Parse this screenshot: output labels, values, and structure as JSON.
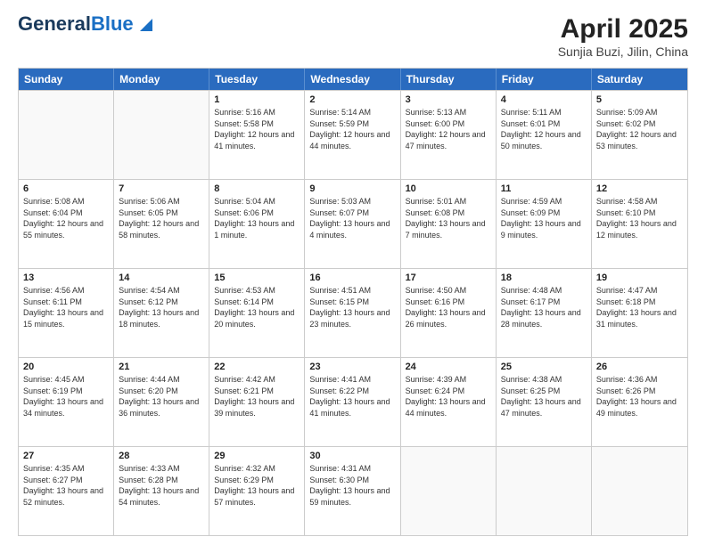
{
  "header": {
    "logo_general": "General",
    "logo_blue": "Blue",
    "title": "April 2025",
    "subtitle": "Sunjia Buzi, Jilin, China"
  },
  "calendar": {
    "days_of_week": [
      "Sunday",
      "Monday",
      "Tuesday",
      "Wednesday",
      "Thursday",
      "Friday",
      "Saturday"
    ],
    "weeks": [
      [
        {
          "day": "",
          "sunrise": "",
          "sunset": "",
          "daylight": "",
          "empty": true
        },
        {
          "day": "",
          "sunrise": "",
          "sunset": "",
          "daylight": "",
          "empty": true
        },
        {
          "day": "1",
          "sunrise": "Sunrise: 5:16 AM",
          "sunset": "Sunset: 5:58 PM",
          "daylight": "Daylight: 12 hours and 41 minutes.",
          "empty": false
        },
        {
          "day": "2",
          "sunrise": "Sunrise: 5:14 AM",
          "sunset": "Sunset: 5:59 PM",
          "daylight": "Daylight: 12 hours and 44 minutes.",
          "empty": false
        },
        {
          "day": "3",
          "sunrise": "Sunrise: 5:13 AM",
          "sunset": "Sunset: 6:00 PM",
          "daylight": "Daylight: 12 hours and 47 minutes.",
          "empty": false
        },
        {
          "day": "4",
          "sunrise": "Sunrise: 5:11 AM",
          "sunset": "Sunset: 6:01 PM",
          "daylight": "Daylight: 12 hours and 50 minutes.",
          "empty": false
        },
        {
          "day": "5",
          "sunrise": "Sunrise: 5:09 AM",
          "sunset": "Sunset: 6:02 PM",
          "daylight": "Daylight: 12 hours and 53 minutes.",
          "empty": false
        }
      ],
      [
        {
          "day": "6",
          "sunrise": "Sunrise: 5:08 AM",
          "sunset": "Sunset: 6:04 PM",
          "daylight": "Daylight: 12 hours and 55 minutes.",
          "empty": false
        },
        {
          "day": "7",
          "sunrise": "Sunrise: 5:06 AM",
          "sunset": "Sunset: 6:05 PM",
          "daylight": "Daylight: 12 hours and 58 minutes.",
          "empty": false
        },
        {
          "day": "8",
          "sunrise": "Sunrise: 5:04 AM",
          "sunset": "Sunset: 6:06 PM",
          "daylight": "Daylight: 13 hours and 1 minute.",
          "empty": false
        },
        {
          "day": "9",
          "sunrise": "Sunrise: 5:03 AM",
          "sunset": "Sunset: 6:07 PM",
          "daylight": "Daylight: 13 hours and 4 minutes.",
          "empty": false
        },
        {
          "day": "10",
          "sunrise": "Sunrise: 5:01 AM",
          "sunset": "Sunset: 6:08 PM",
          "daylight": "Daylight: 13 hours and 7 minutes.",
          "empty": false
        },
        {
          "day": "11",
          "sunrise": "Sunrise: 4:59 AM",
          "sunset": "Sunset: 6:09 PM",
          "daylight": "Daylight: 13 hours and 9 minutes.",
          "empty": false
        },
        {
          "day": "12",
          "sunrise": "Sunrise: 4:58 AM",
          "sunset": "Sunset: 6:10 PM",
          "daylight": "Daylight: 13 hours and 12 minutes.",
          "empty": false
        }
      ],
      [
        {
          "day": "13",
          "sunrise": "Sunrise: 4:56 AM",
          "sunset": "Sunset: 6:11 PM",
          "daylight": "Daylight: 13 hours and 15 minutes.",
          "empty": false
        },
        {
          "day": "14",
          "sunrise": "Sunrise: 4:54 AM",
          "sunset": "Sunset: 6:12 PM",
          "daylight": "Daylight: 13 hours and 18 minutes.",
          "empty": false
        },
        {
          "day": "15",
          "sunrise": "Sunrise: 4:53 AM",
          "sunset": "Sunset: 6:14 PM",
          "daylight": "Daylight: 13 hours and 20 minutes.",
          "empty": false
        },
        {
          "day": "16",
          "sunrise": "Sunrise: 4:51 AM",
          "sunset": "Sunset: 6:15 PM",
          "daylight": "Daylight: 13 hours and 23 minutes.",
          "empty": false
        },
        {
          "day": "17",
          "sunrise": "Sunrise: 4:50 AM",
          "sunset": "Sunset: 6:16 PM",
          "daylight": "Daylight: 13 hours and 26 minutes.",
          "empty": false
        },
        {
          "day": "18",
          "sunrise": "Sunrise: 4:48 AM",
          "sunset": "Sunset: 6:17 PM",
          "daylight": "Daylight: 13 hours and 28 minutes.",
          "empty": false
        },
        {
          "day": "19",
          "sunrise": "Sunrise: 4:47 AM",
          "sunset": "Sunset: 6:18 PM",
          "daylight": "Daylight: 13 hours and 31 minutes.",
          "empty": false
        }
      ],
      [
        {
          "day": "20",
          "sunrise": "Sunrise: 4:45 AM",
          "sunset": "Sunset: 6:19 PM",
          "daylight": "Daylight: 13 hours and 34 minutes.",
          "empty": false
        },
        {
          "day": "21",
          "sunrise": "Sunrise: 4:44 AM",
          "sunset": "Sunset: 6:20 PM",
          "daylight": "Daylight: 13 hours and 36 minutes.",
          "empty": false
        },
        {
          "day": "22",
          "sunrise": "Sunrise: 4:42 AM",
          "sunset": "Sunset: 6:21 PM",
          "daylight": "Daylight: 13 hours and 39 minutes.",
          "empty": false
        },
        {
          "day": "23",
          "sunrise": "Sunrise: 4:41 AM",
          "sunset": "Sunset: 6:22 PM",
          "daylight": "Daylight: 13 hours and 41 minutes.",
          "empty": false
        },
        {
          "day": "24",
          "sunrise": "Sunrise: 4:39 AM",
          "sunset": "Sunset: 6:24 PM",
          "daylight": "Daylight: 13 hours and 44 minutes.",
          "empty": false
        },
        {
          "day": "25",
          "sunrise": "Sunrise: 4:38 AM",
          "sunset": "Sunset: 6:25 PM",
          "daylight": "Daylight: 13 hours and 47 minutes.",
          "empty": false
        },
        {
          "day": "26",
          "sunrise": "Sunrise: 4:36 AM",
          "sunset": "Sunset: 6:26 PM",
          "daylight": "Daylight: 13 hours and 49 minutes.",
          "empty": false
        }
      ],
      [
        {
          "day": "27",
          "sunrise": "Sunrise: 4:35 AM",
          "sunset": "Sunset: 6:27 PM",
          "daylight": "Daylight: 13 hours and 52 minutes.",
          "empty": false
        },
        {
          "day": "28",
          "sunrise": "Sunrise: 4:33 AM",
          "sunset": "Sunset: 6:28 PM",
          "daylight": "Daylight: 13 hours and 54 minutes.",
          "empty": false
        },
        {
          "day": "29",
          "sunrise": "Sunrise: 4:32 AM",
          "sunset": "Sunset: 6:29 PM",
          "daylight": "Daylight: 13 hours and 57 minutes.",
          "empty": false
        },
        {
          "day": "30",
          "sunrise": "Sunrise: 4:31 AM",
          "sunset": "Sunset: 6:30 PM",
          "daylight": "Daylight: 13 hours and 59 minutes.",
          "empty": false
        },
        {
          "day": "",
          "sunrise": "",
          "sunset": "",
          "daylight": "",
          "empty": true
        },
        {
          "day": "",
          "sunrise": "",
          "sunset": "",
          "daylight": "",
          "empty": true
        },
        {
          "day": "",
          "sunrise": "",
          "sunset": "",
          "daylight": "",
          "empty": true
        }
      ]
    ]
  }
}
